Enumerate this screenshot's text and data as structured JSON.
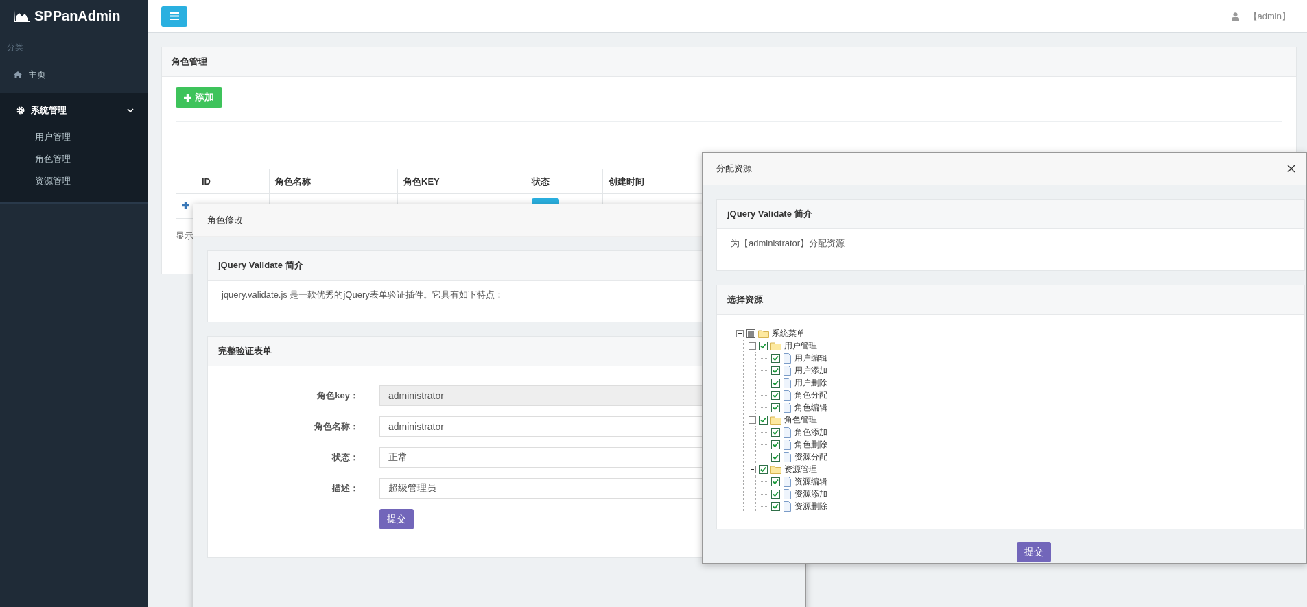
{
  "sidebar": {
    "brand": "SPPanAdmin",
    "section_label": "分类",
    "items": [
      {
        "label": "主页",
        "kind": "link"
      },
      {
        "label": "系统管理",
        "kind": "group",
        "expanded": true,
        "children": [
          {
            "label": "用户管理"
          },
          {
            "label": "角色管理"
          },
          {
            "label": "资源管理"
          }
        ]
      }
    ]
  },
  "header": {
    "user": "【admin】"
  },
  "page": {
    "title": "角色管理",
    "add_button": "添加",
    "table": {
      "columns": [
        "ID",
        "角色名称",
        "角色KEY",
        "状态",
        "创建时间"
      ]
    },
    "footer": "显示"
  },
  "edit_dialog": {
    "title": "角色修改",
    "intro": {
      "title": "jQuery Validate 简介",
      "text": "jquery.validate.js 是一款优秀的jQuery表单验证插件。它具有如下特点："
    },
    "form": {
      "title": "完整验证表单",
      "fields": [
        {
          "label": "角色key：",
          "value": "administrator",
          "disabled": true
        },
        {
          "label": "角色名称：",
          "value": "administrator",
          "disabled": false
        },
        {
          "label": "状态：",
          "value": "正常",
          "disabled": false
        },
        {
          "label": "描述：",
          "value": "超级管理员",
          "disabled": false
        }
      ],
      "submit": "提交"
    }
  },
  "assign_dialog": {
    "title": "分配资源",
    "intro": {
      "title": "jQuery Validate 简介",
      "text": "为【administrator】分配资源"
    },
    "resources": {
      "title": "选择资源",
      "tree": [
        {
          "label": "系统菜单",
          "kind": "folder",
          "expanded": true,
          "checked": false,
          "partial": true,
          "children": [
            {
              "label": "用户管理",
              "kind": "folder",
              "expanded": true,
              "checked": true,
              "partial": false,
              "children": [
                {
                  "label": "用户编辑",
                  "kind": "file",
                  "checked": true,
                  "partial": false
                },
                {
                  "label": "用户添加",
                  "kind": "file",
                  "checked": true,
                  "partial": false
                },
                {
                  "label": "用户删除",
                  "kind": "file",
                  "checked": true,
                  "partial": false
                },
                {
                  "label": "角色分配",
                  "kind": "file",
                  "checked": true,
                  "partial": false
                },
                {
                  "label": "角色编辑",
                  "kind": "file",
                  "checked": true,
                  "partial": false
                }
              ]
            },
            {
              "label": "角色管理",
              "kind": "folder",
              "expanded": true,
              "checked": true,
              "partial": false,
              "children": [
                {
                  "label": "角色添加",
                  "kind": "file",
                  "checked": true,
                  "partial": false
                },
                {
                  "label": "角色删除",
                  "kind": "file",
                  "checked": true,
                  "partial": false
                },
                {
                  "label": "资源分配",
                  "kind": "file",
                  "checked": true,
                  "partial": false
                }
              ]
            },
            {
              "label": "资源管理",
              "kind": "folder",
              "expanded": true,
              "checked": true,
              "partial": false,
              "children": [
                {
                  "label": "资源编辑",
                  "kind": "file",
                  "checked": true,
                  "partial": false
                },
                {
                  "label": "资源添加",
                  "kind": "file",
                  "checked": true,
                  "partial": false
                },
                {
                  "label": "资源删除",
                  "kind": "file",
                  "checked": true,
                  "partial": false
                }
              ]
            }
          ]
        }
      ]
    },
    "submit": "提交"
  }
}
